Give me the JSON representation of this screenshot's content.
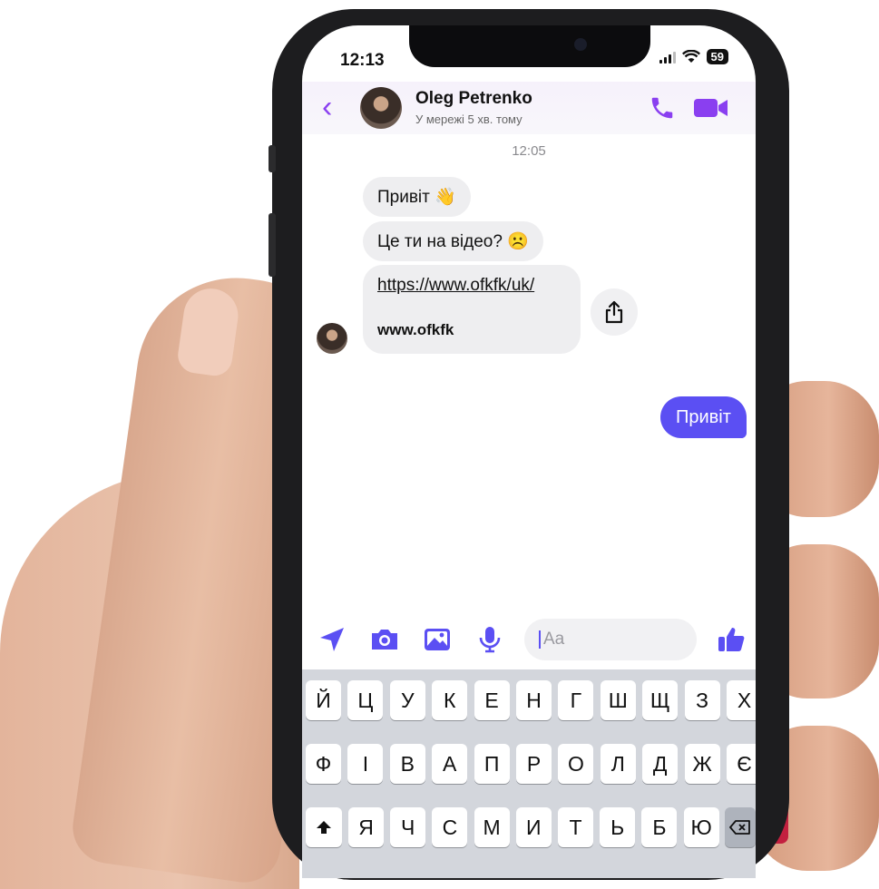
{
  "status_bar": {
    "time": "12:13",
    "battery": "59"
  },
  "header": {
    "contact_name": "Oleg Petrenko",
    "contact_status": "У мережі 5 хв. тому"
  },
  "chat": {
    "timestamp": "12:05",
    "received": [
      {
        "text": "Привіт 👋"
      },
      {
        "text": "Це ти на відео? ☹️"
      }
    ],
    "link_preview": {
      "url": "https://www.ofkfk/uk/",
      "title": "www.ofkfk"
    },
    "sent": [
      {
        "text": "Привіт"
      }
    ]
  },
  "composer": {
    "placeholder": "Aa"
  },
  "keyboard": {
    "row1": [
      "Й",
      "Ц",
      "У",
      "К",
      "Е",
      "Н",
      "Г",
      "Ш",
      "Щ",
      "З",
      "Х"
    ],
    "row2": [
      "Ф",
      "І",
      "В",
      "А",
      "П",
      "Р",
      "О",
      "Л",
      "Д",
      "Ж",
      "Є"
    ],
    "row3": [
      "Я",
      "Ч",
      "С",
      "М",
      "И",
      "Т",
      "Ь",
      "Б",
      "Ю"
    ]
  },
  "colors": {
    "accent": "#5b4ff3",
    "header_icons": "#8a3ff0"
  }
}
